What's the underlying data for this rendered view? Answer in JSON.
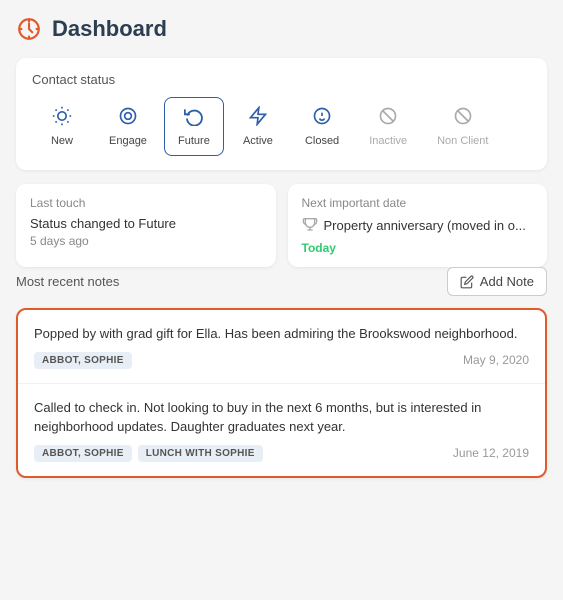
{
  "header": {
    "title": "Dashboard",
    "icon": "dashboard-icon"
  },
  "contact_status": {
    "label": "Contact status",
    "tabs": [
      {
        "id": "new",
        "label": "New",
        "icon": "☀",
        "active": false,
        "inactive": false
      },
      {
        "id": "engage",
        "label": "Engage",
        "icon": "◎",
        "active": false,
        "inactive": false
      },
      {
        "id": "future",
        "label": "Future",
        "icon": "↺",
        "active": true,
        "inactive": false
      },
      {
        "id": "active",
        "label": "Active",
        "icon": "⚡",
        "active": false,
        "inactive": false
      },
      {
        "id": "closed",
        "label": "Closed",
        "icon": "💰",
        "active": false,
        "inactive": false
      },
      {
        "id": "inactive",
        "label": "Inactive",
        "icon": "⊘",
        "active": false,
        "inactive": true
      },
      {
        "id": "nonclient",
        "label": "Non Client",
        "icon": "⊘",
        "active": false,
        "inactive": true
      }
    ]
  },
  "last_touch": {
    "label": "Last touch",
    "status": "Status changed to Future",
    "time": "5 days ago"
  },
  "next_date": {
    "label": "Next important date",
    "event": "Property anniversary (moved in o...",
    "date": "Today"
  },
  "notes": {
    "section_label": "Most recent notes",
    "add_button_label": "Add Note",
    "items": [
      {
        "id": 1,
        "text": "Popped by with grad gift for Ella. Has been admiring the Brookswood neighborhood.",
        "tags": [
          "ABBOT, SOPHIE"
        ],
        "date": "May 9, 2020"
      },
      {
        "id": 2,
        "text": "Called to check in. Not looking to buy in the next 6 months, but is interested in neighborhood updates. Daughter graduates next year.",
        "tags": [
          "ABBOT, SOPHIE",
          "LUNCH WITH SOPHIE"
        ],
        "date": "June 12, 2019"
      }
    ]
  }
}
